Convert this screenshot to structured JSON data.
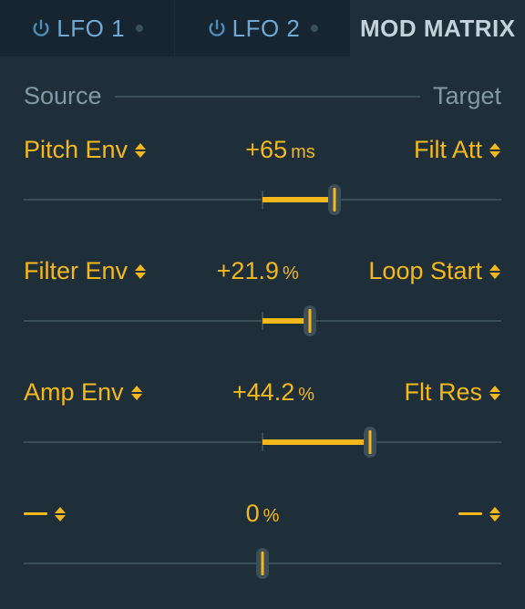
{
  "tabs": {
    "lfo1": "LFO 1",
    "lfo2": "LFO 2",
    "modmatrix": "MOD MATRIX"
  },
  "header": {
    "source": "Source",
    "target": "Target"
  },
  "rows": [
    {
      "source": "Pitch Env",
      "value": "+65",
      "unit": "ms",
      "target": "Filt Att",
      "pct": 65.0
    },
    {
      "source": "Filter Env",
      "value": "+21.9",
      "unit": "%",
      "target": "Loop Start",
      "pct": 60.0
    },
    {
      "source": "Amp Env",
      "value": "+44.2",
      "unit": "%",
      "target": "Flt Res",
      "pct": 72.5
    },
    {
      "source": "",
      "value": "0",
      "unit": "%",
      "target": "",
      "pct": 50.0
    }
  ]
}
